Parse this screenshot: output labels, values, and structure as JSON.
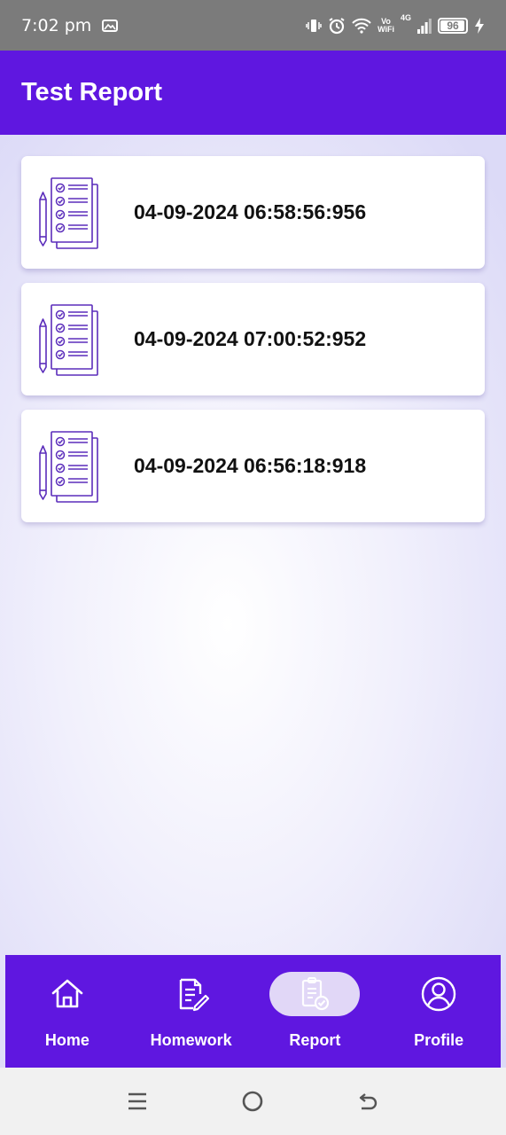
{
  "status_bar": {
    "time": "7:02 pm",
    "volte_top": "Vo",
    "volte_bottom": "WiFi",
    "network": "4G",
    "battery": "96"
  },
  "app_bar": {
    "title": "Test Report"
  },
  "reports": [
    {
      "label": "04-09-2024 06:58:56:956"
    },
    {
      "label": "04-09-2024 07:00:52:952"
    },
    {
      "label": "04-09-2024 06:56:18:918"
    }
  ],
  "bottom_nav": {
    "home": "Home",
    "homework": "Homework",
    "report": "Report",
    "profile": "Profile",
    "active": "report"
  },
  "colors": {
    "primary": "#5f17e0",
    "icon_accent": "#5b2dbb",
    "active_pill": "#e1d7f7"
  },
  "battery_level": 0.96
}
